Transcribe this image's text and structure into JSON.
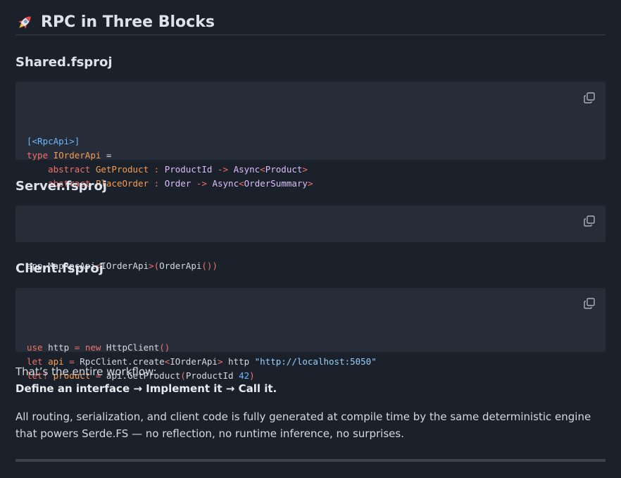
{
  "title": "RPC in Three Blocks",
  "sections": [
    {
      "heading": "Shared.fsproj",
      "lines": [
        [
          [
            "at",
            "[<RpcApi>]"
          ]
        ],
        [
          [
            "kw",
            "type "
          ],
          [
            "fn",
            "IOrderApi"
          ],
          [
            "pl",
            " ="
          ]
        ],
        [
          [
            "pl",
            "    "
          ],
          [
            "kw",
            "abstract "
          ],
          [
            "fn",
            "GetProduct"
          ],
          [
            "pl",
            " "
          ],
          [
            "kw",
            ":"
          ],
          [
            "pl",
            " "
          ],
          [
            "ty",
            "ProductId"
          ],
          [
            "pl",
            " "
          ],
          [
            "kw",
            "->"
          ],
          [
            "pl",
            " "
          ],
          [
            "ty",
            "Async"
          ],
          [
            "kw",
            "<"
          ],
          [
            "ty",
            "Product"
          ],
          [
            "kw",
            ">"
          ]
        ],
        [
          [
            "pl",
            "    "
          ],
          [
            "kw",
            "abstract "
          ],
          [
            "fn",
            "PlaceOrder"
          ],
          [
            "pl",
            " "
          ],
          [
            "kw",
            ":"
          ],
          [
            "pl",
            " "
          ],
          [
            "ty",
            "Order"
          ],
          [
            "pl",
            " "
          ],
          [
            "kw",
            "->"
          ],
          [
            "pl",
            " "
          ],
          [
            "ty",
            "Async"
          ],
          [
            "kw",
            "<"
          ],
          [
            "ty",
            "OrderSummary"
          ],
          [
            "kw",
            ">"
          ]
        ]
      ]
    },
    {
      "heading": "Server.fsproj",
      "lines": [
        [
          [
            "pl",
            "app.MapRpcApi"
          ],
          [
            "kw",
            "<"
          ],
          [
            "pl",
            "IOrderApi"
          ],
          [
            "kw",
            ">"
          ],
          [
            "kw",
            "("
          ],
          [
            "pl",
            "OrderApi"
          ],
          [
            "kw",
            "()"
          ],
          [
            "kw",
            ")"
          ]
        ]
      ]
    },
    {
      "heading": "Client.fsproj",
      "lines": [
        [
          [
            "kw",
            "use "
          ],
          [
            "pl",
            "http "
          ],
          [
            "kw",
            "="
          ],
          [
            "pl",
            " "
          ],
          [
            "kw",
            "new "
          ],
          [
            "pl",
            "HttpClient"
          ],
          [
            "kw",
            "()"
          ]
        ],
        [
          [
            "kw",
            "let "
          ],
          [
            "fn",
            "api"
          ],
          [
            "pl",
            " "
          ],
          [
            "kw",
            "="
          ],
          [
            "pl",
            " RpcClient.create"
          ],
          [
            "kw",
            "<"
          ],
          [
            "pl",
            "IOrderApi"
          ],
          [
            "kw",
            ">"
          ],
          [
            "pl",
            " http "
          ],
          [
            "st",
            "\"http://localhost:5050\""
          ]
        ],
        [
          [
            "kw",
            "let! "
          ],
          [
            "fn",
            "product"
          ],
          [
            "pl",
            " "
          ],
          [
            "kw",
            "="
          ],
          [
            "pl",
            " api.GetProduct"
          ],
          [
            "kw",
            "("
          ],
          [
            "pl",
            "ProductId "
          ],
          [
            "nu",
            "42"
          ],
          [
            "kw",
            ")"
          ]
        ]
      ]
    }
  ],
  "summary": {
    "intro": "That’s the entire workflow:",
    "steps": "Define an interface → Implement it → Call it."
  },
  "closing": "All routing, serialization, and client code is fully generated at compile time by the same deterministic engine that powers Serde.FS — no reflection, no runtime inference, no surprises.",
  "icons": {
    "title_icon": "rocket-icon",
    "copy_icon": "copy-icon"
  },
  "colors": {
    "background": "#1b212b",
    "code_background": "#262d38",
    "keyword": "#f47067",
    "type": "#dcbdfb",
    "attribute": "#6cb6ff",
    "function": "#f69d50",
    "string": "#96d0ff"
  }
}
